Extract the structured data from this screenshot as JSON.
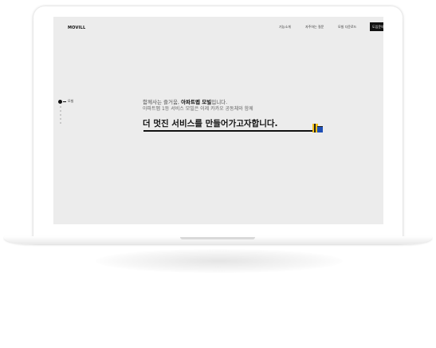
{
  "site": {
    "logo": "MOVILL",
    "nav": [
      "기능소개",
      "자주하는 질문",
      "모빌 다운로드"
    ],
    "cta": "도입문의"
  },
  "section_nav": {
    "active_label": "모빌",
    "inactive_count": 5
  },
  "hero": {
    "intro_pre": "함께사는 즐거움, ",
    "intro_bold": "아파트멥 모빌",
    "intro_post": "입니다.",
    "line2": "아파트멥 1등 서비스 모빌은 이제 카카오 공동체와 함께",
    "headline": "더 멋진 서비스를 만들어가고자합니다."
  },
  "colors": {
    "screen_bg": "#ececec",
    "accent_yellow": "#f6c21b",
    "accent_blue": "#1e4fb5",
    "text_dark": "#111111"
  }
}
